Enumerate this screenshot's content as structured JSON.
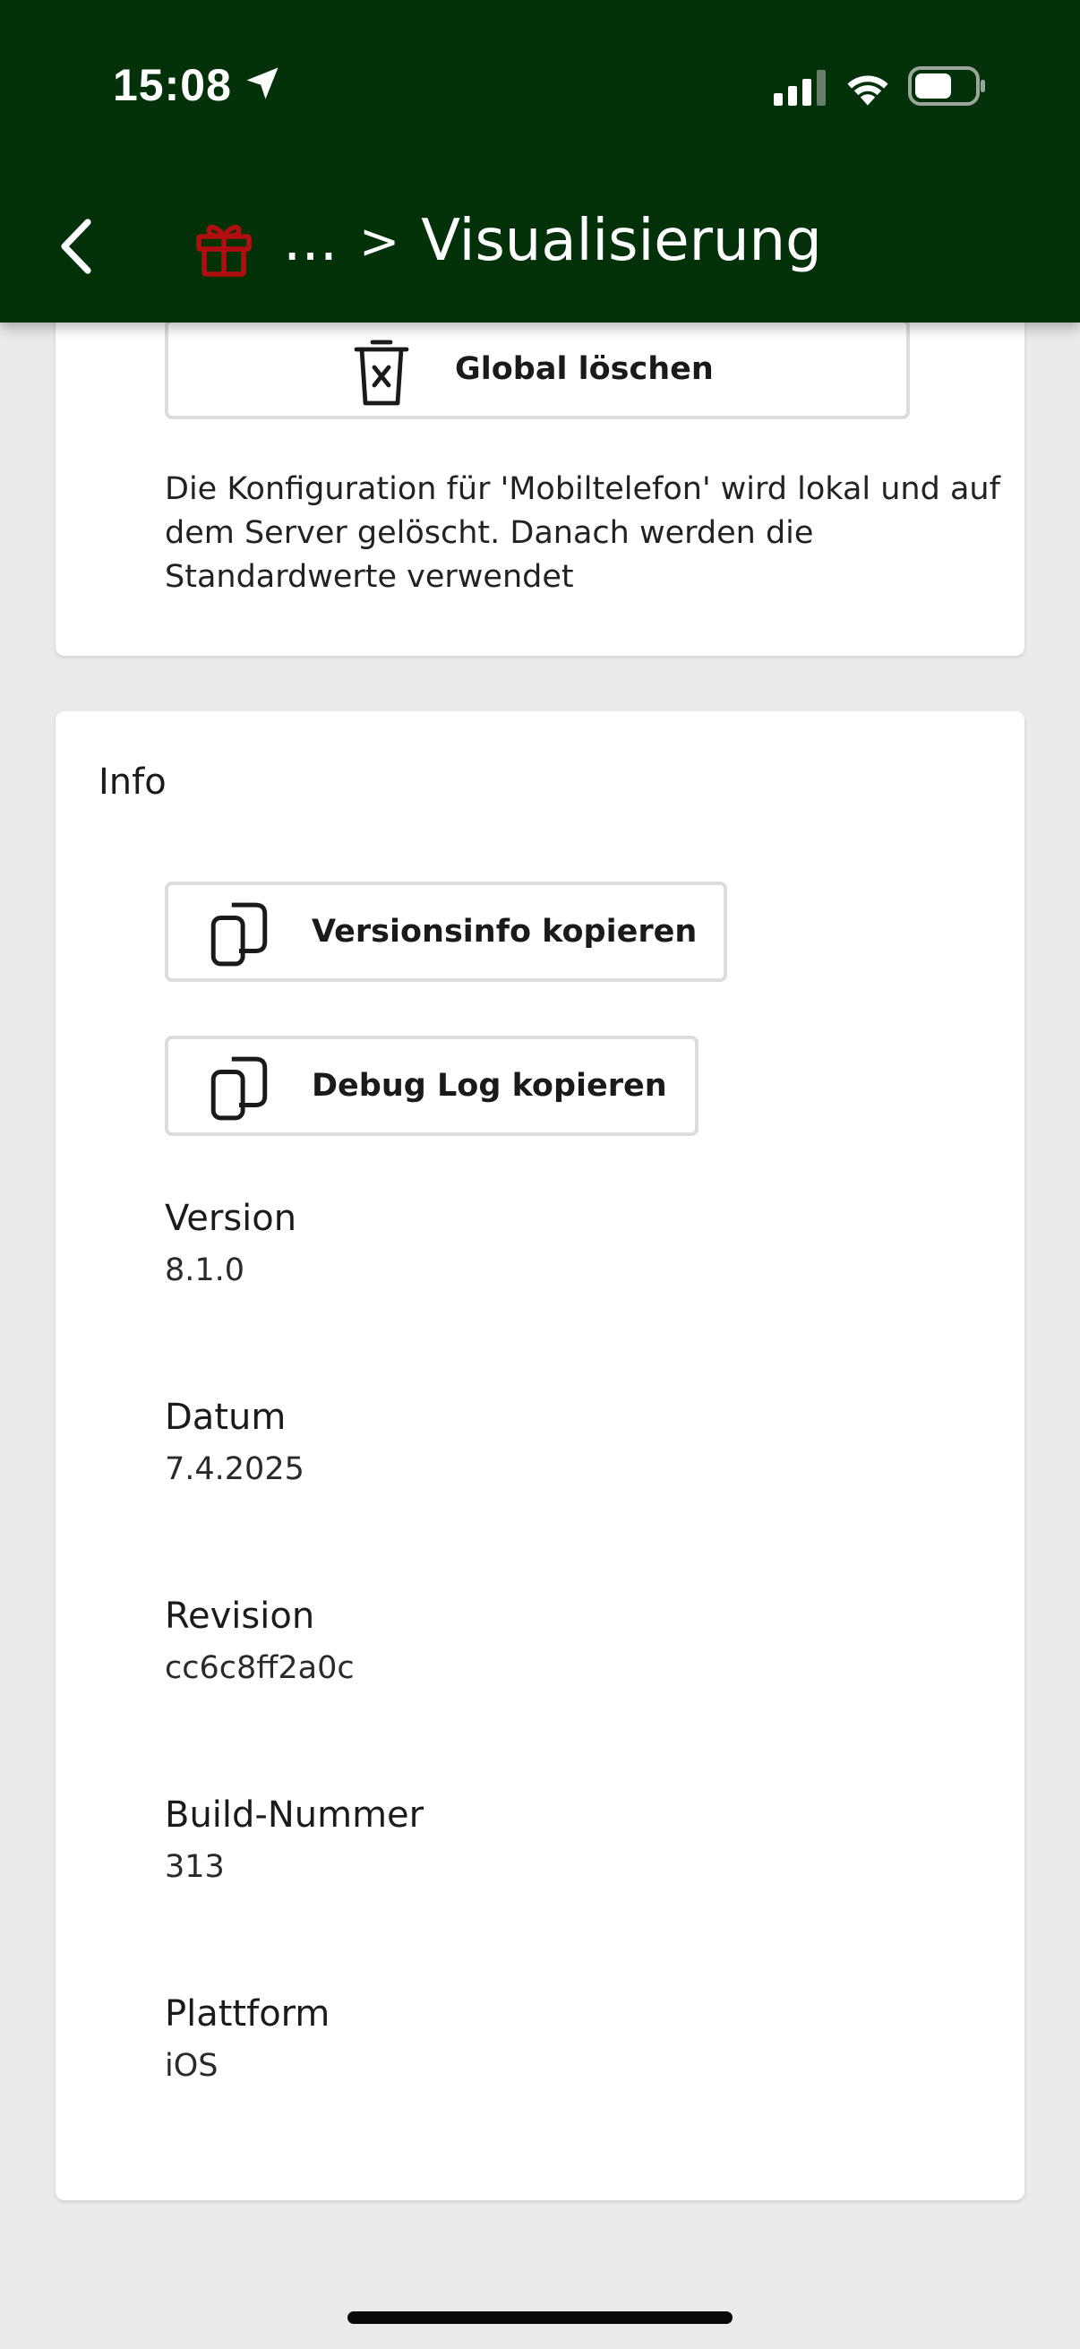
{
  "status_bar": {
    "time": "15:08"
  },
  "header": {
    "breadcrumb_ellipsis": "...",
    "breadcrumb_separator": ">",
    "title": "Visualisierung",
    "gift_color": "#b10f0f"
  },
  "reset_card": {
    "global_delete_label": "Global löschen",
    "description": "Die Konfiguration für 'Mobiltelefon' wird lokal und auf dem Server gelöscht. Danach werden die Standardwerte verwendet"
  },
  "info_card": {
    "title": "Info",
    "copy_version_label": "Versionsinfo kopieren",
    "copy_debug_label": "Debug Log kopieren",
    "fields": [
      {
        "label": "Version",
        "value": "8.1.0"
      },
      {
        "label": "Datum",
        "value": "7.4.2025"
      },
      {
        "label": "Revision",
        "value": "cc6c8ff2a0c"
      },
      {
        "label": "Build-Nummer",
        "value": "313"
      },
      {
        "label": "Plattform",
        "value": "iOS"
      }
    ]
  }
}
